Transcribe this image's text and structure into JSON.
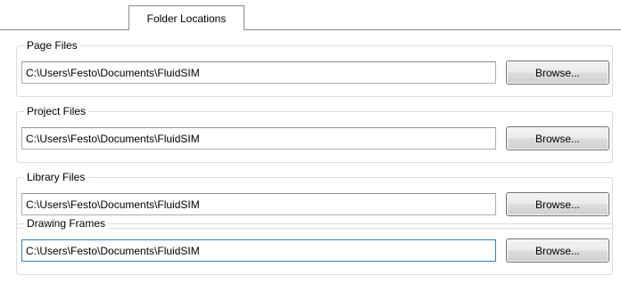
{
  "tabs": [
    {
      "label": "Folder Locations",
      "active": true
    }
  ],
  "groups": [
    {
      "title": "Page Files",
      "path": "C:\\Users\\Festo\\Documents\\FluidSIM",
      "button_label": "Browse..."
    },
    {
      "title": "Project Files",
      "path": "C:\\Users\\Festo\\Documents\\FluidSIM",
      "button_label": "Browse..."
    },
    {
      "title": "Library Files",
      "path": "C:\\Users\\Festo\\Documents\\FluidSIM",
      "button_label": "Browse..."
    },
    {
      "title": "Drawing Frames",
      "path": "C:\\Users\\Festo\\Documents\\FluidSIM",
      "button_label": "Browse...",
      "focused": true
    }
  ],
  "colors": {
    "tab_border": "#898c95",
    "group_border": "#dcdcdc",
    "input_border": "#abadb3",
    "input_focus_border": "#3c7fb1",
    "button_border": "#707070"
  }
}
